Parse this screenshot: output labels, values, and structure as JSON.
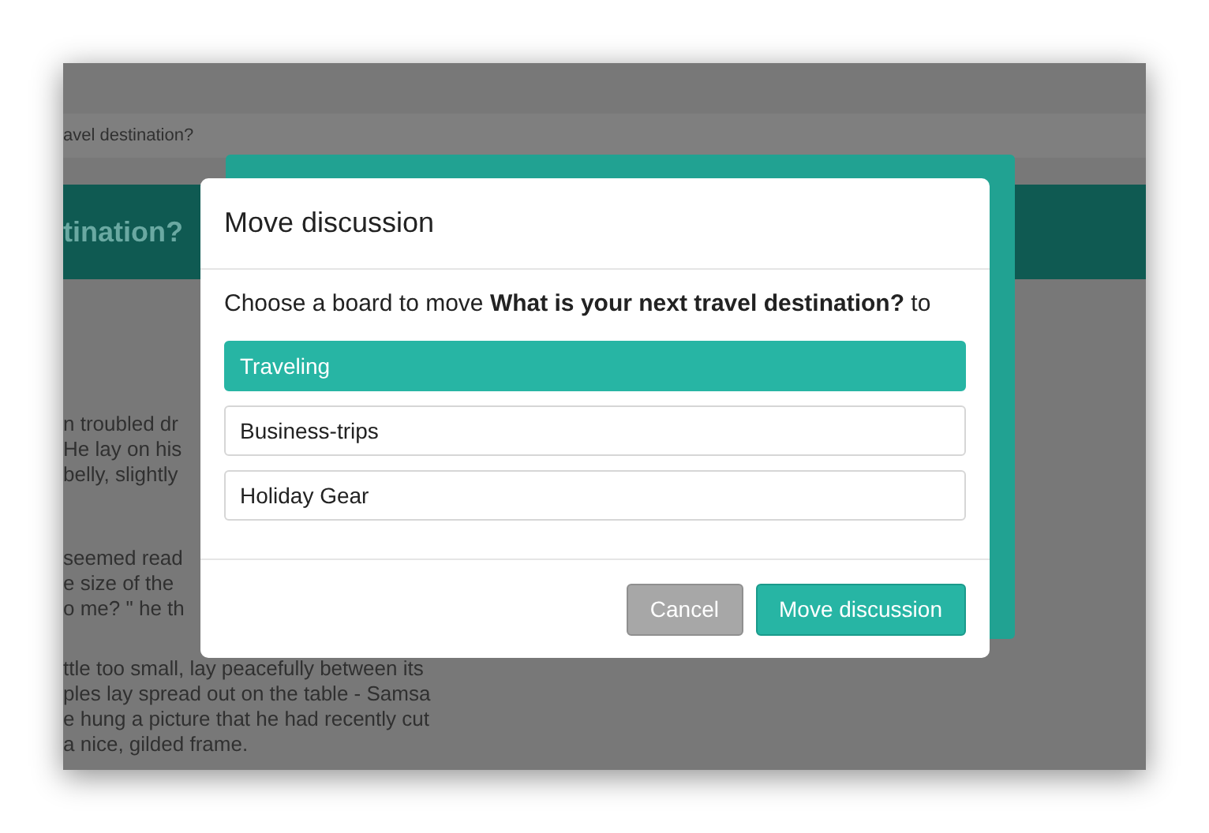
{
  "background": {
    "breadcrumb": "avel destination?",
    "heading": "tination?",
    "paragraphs": [
      [
        "n troubled dr",
        "He lay on his",
        "belly, slightly"
      ],
      [
        "seemed read",
        "e size of the",
        "o me? \" he th"
      ],
      [
        "ttle too small, lay peacefully between its",
        "ples lay spread out on the table - Samsa",
        "e hung a picture that he had recently cut",
        "a nice, gilded frame."
      ]
    ]
  },
  "dialog": {
    "title": "Move discussion",
    "prompt": "Choose a board to move **What is your next travel destination?** to",
    "boards": [
      {
        "label": "Traveling",
        "selected": true
      },
      {
        "label": "Business-trips",
        "selected": false
      },
      {
        "label": "Holiday Gear",
        "selected": false
      }
    ],
    "buttons": [
      {
        "label": "Cancel",
        "kind": "secondary"
      },
      {
        "label": "Move discussion",
        "kind": "primary"
      }
    ]
  }
}
